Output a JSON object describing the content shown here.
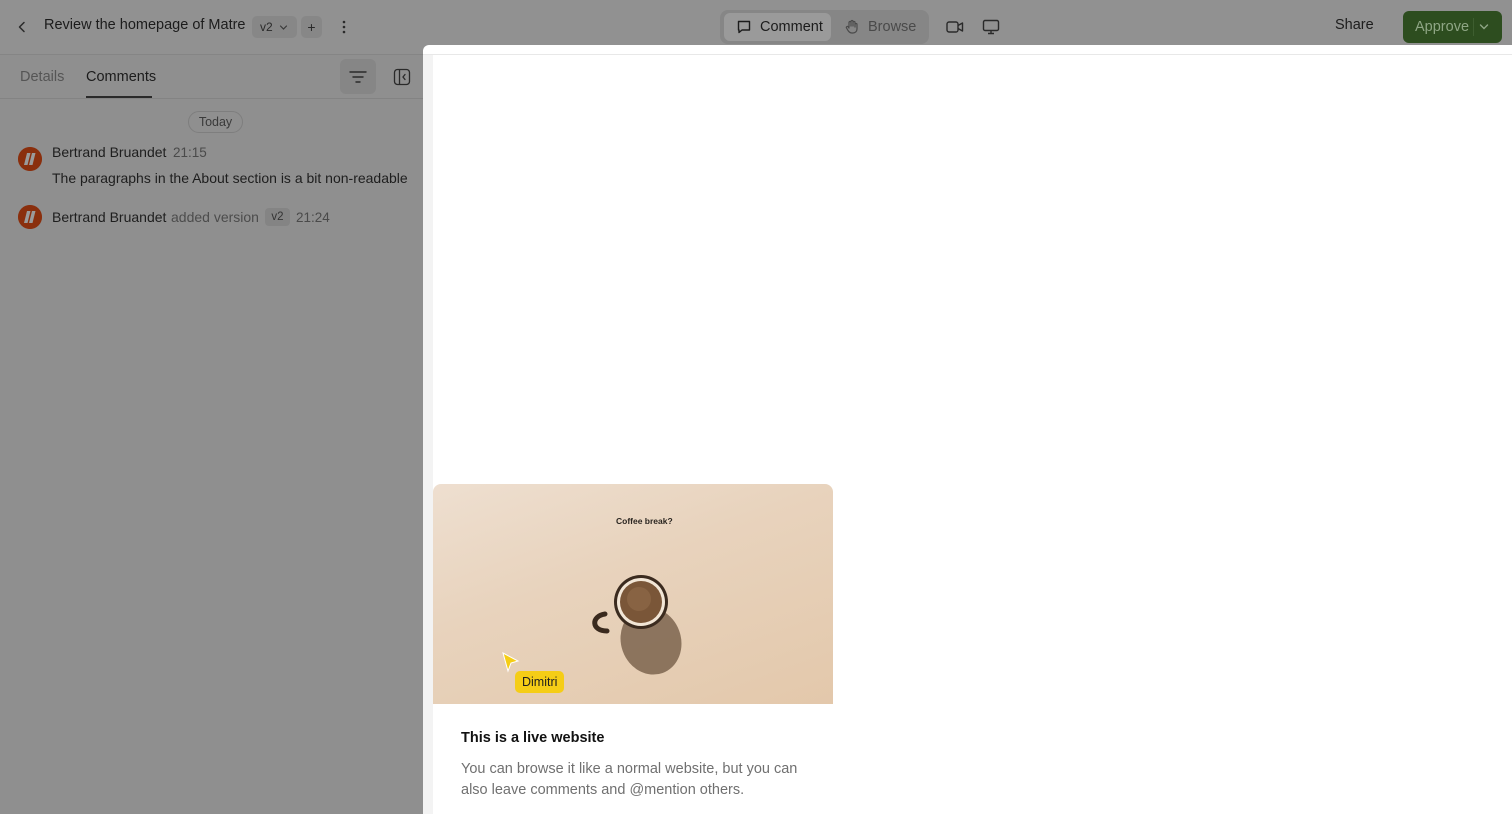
{
  "header": {
    "title": "Review the homepage of Matre",
    "version": "v2",
    "add_label": "+",
    "modes": [
      {
        "label": "Comment",
        "icon": "comment-icon",
        "active": true
      },
      {
        "label": "Browse",
        "icon": "hand-icon",
        "active": false
      }
    ],
    "share_label": "Share",
    "approve_label": "Approve",
    "approve_color": "#2d4d1f"
  },
  "sidebar": {
    "tabs": [
      {
        "label": "Details",
        "active": false
      },
      {
        "label": "Comments",
        "active": true
      }
    ],
    "date_label": "Today",
    "activity": [
      {
        "type": "comment",
        "author": "Bertrand Bruandet",
        "time": "21:15",
        "body": "The paragraphs in the About section is a bit non-readable"
      },
      {
        "type": "version",
        "author": "Bertrand Bruandet",
        "action": "added version",
        "version": "v2",
        "time": "21:24"
      }
    ]
  },
  "onboarding": {
    "image_caption": "Coffee break?",
    "cursor_user": "Dimitri",
    "cursor_color": "#f5cd16",
    "title": "This is a live website",
    "description": "You can browse it like a normal website, but you can also leave comments and @mention others."
  }
}
